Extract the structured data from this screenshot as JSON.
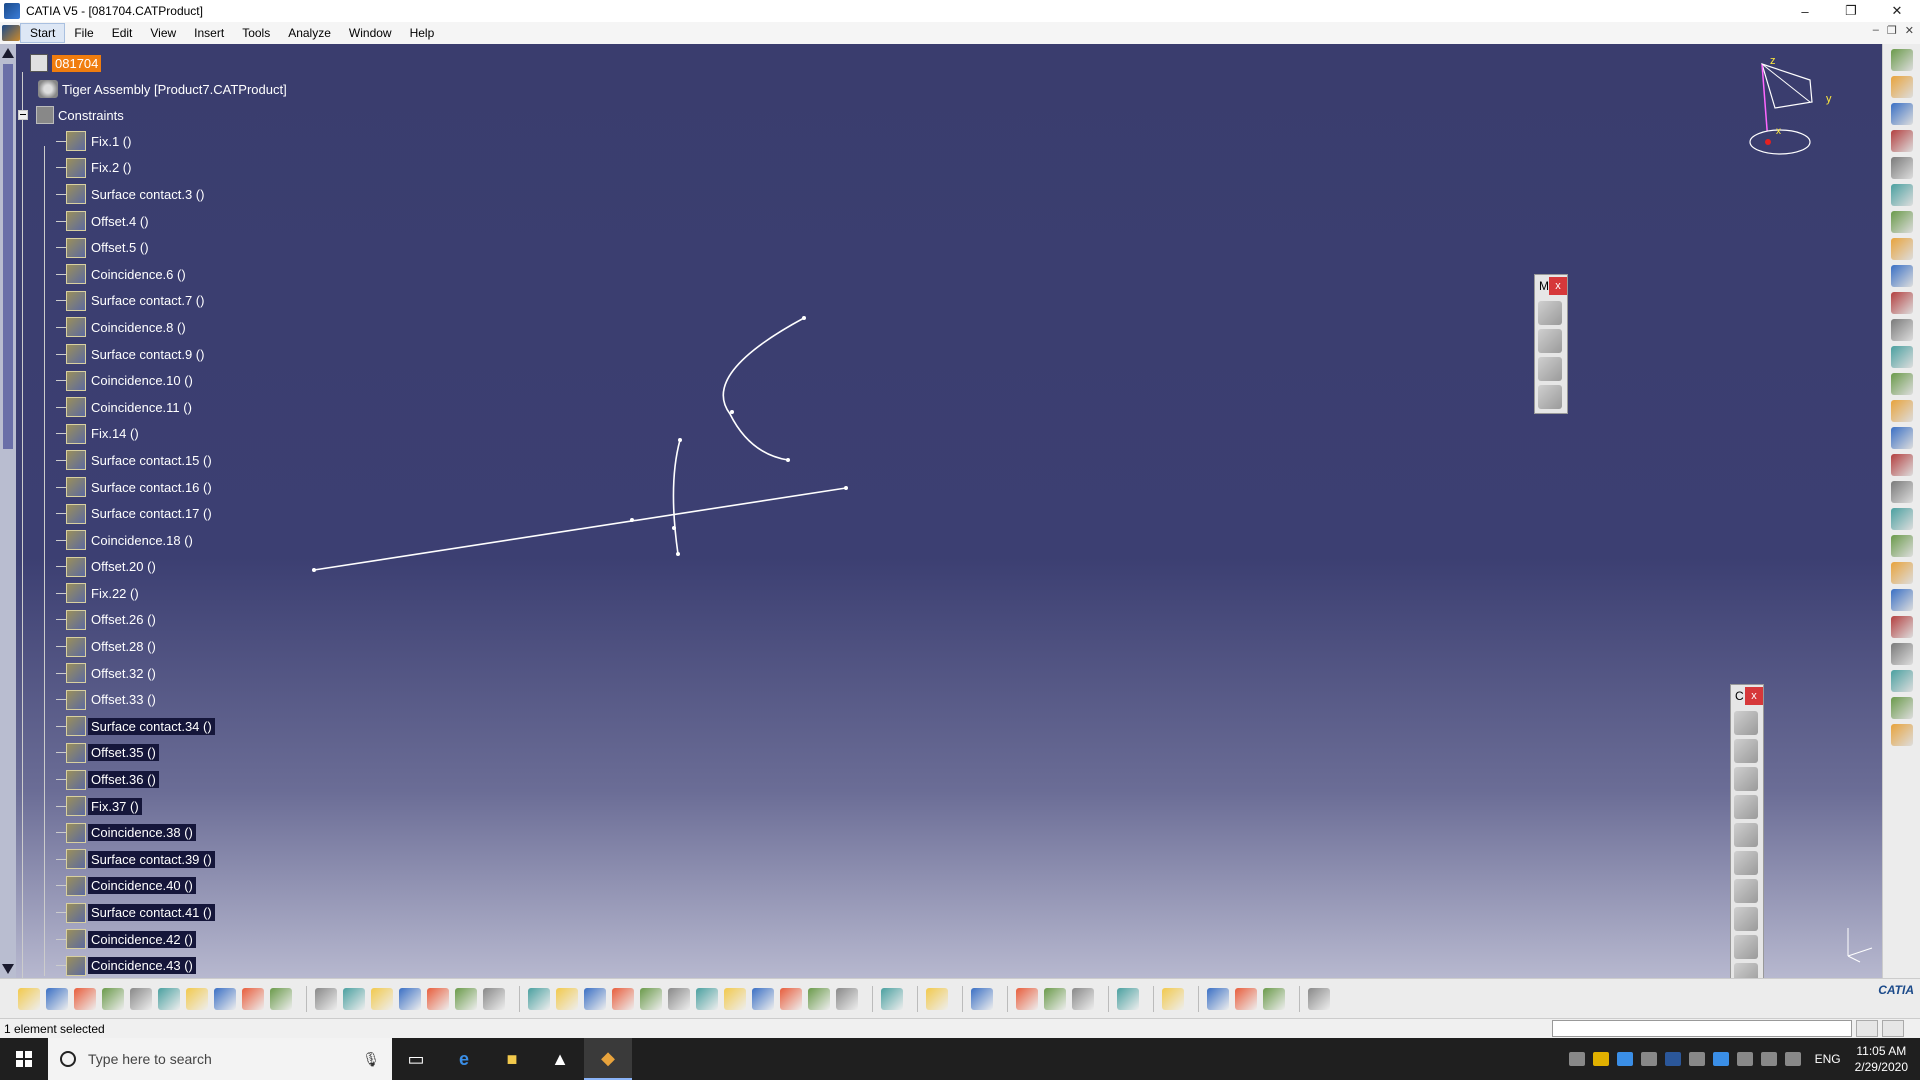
{
  "window": {
    "title": "CATIA V5 - [081704.CATProduct]",
    "minimize": "–",
    "restore": "❐",
    "close": "✕"
  },
  "menu": {
    "items": [
      "Start",
      "File",
      "Edit",
      "View",
      "Insert",
      "Tools",
      "Analyze",
      "Window",
      "Help"
    ]
  },
  "tree": {
    "root_label": "081704",
    "product_label": "Tiger Assembly [Product7.CATProduct]",
    "constraints_label": "Constraints",
    "constraints": [
      {
        "label": "Fix.1 ()",
        "selected": false
      },
      {
        "label": "Fix.2 ()",
        "selected": false
      },
      {
        "label": "Surface contact.3 ()",
        "selected": false
      },
      {
        "label": "Offset.4 ()",
        "selected": false
      },
      {
        "label": "Offset.5 ()",
        "selected": false
      },
      {
        "label": "Coincidence.6 ()",
        "selected": false
      },
      {
        "label": "Surface contact.7 ()",
        "selected": false
      },
      {
        "label": "Coincidence.8 ()",
        "selected": false
      },
      {
        "label": "Surface contact.9 ()",
        "selected": false
      },
      {
        "label": "Coincidence.10 ()",
        "selected": false
      },
      {
        "label": "Coincidence.11 ()",
        "selected": false
      },
      {
        "label": "Fix.14 ()",
        "selected": false
      },
      {
        "label": "Surface contact.15 ()",
        "selected": false
      },
      {
        "label": "Surface contact.16 ()",
        "selected": false
      },
      {
        "label": "Surface contact.17 ()",
        "selected": false
      },
      {
        "label": "Coincidence.18 ()",
        "selected": false
      },
      {
        "label": "Offset.20 ()",
        "selected": false
      },
      {
        "label": "Fix.22 ()",
        "selected": false
      },
      {
        "label": "Offset.26 ()",
        "selected": false
      },
      {
        "label": "Offset.28 ()",
        "selected": false
      },
      {
        "label": "Offset.32 ()",
        "selected": false
      },
      {
        "label": "Offset.33 ()",
        "selected": false
      },
      {
        "label": "Surface contact.34 ()",
        "selected": true
      },
      {
        "label": "Offset.35 ()",
        "selected": true
      },
      {
        "label": "Offset.36 ()",
        "selected": true
      },
      {
        "label": "Fix.37 ()",
        "selected": true
      },
      {
        "label": "Coincidence.38 ()",
        "selected": true
      },
      {
        "label": "Surface contact.39 ()",
        "selected": true
      },
      {
        "label": "Coincidence.40 ()",
        "selected": true
      },
      {
        "label": "Surface contact.41 ()",
        "selected": true
      },
      {
        "label": "Coincidence.42 ()",
        "selected": true
      },
      {
        "label": "Coincidence.43 ()",
        "selected": true
      }
    ]
  },
  "compass": {
    "z_label": "z",
    "y_label": "y",
    "x_label": "x"
  },
  "float_toolbar_1": {
    "title": "M",
    "close": "x",
    "tools": [
      "move-tool",
      "rotate-tool",
      "snap-tool",
      "explode-tool"
    ]
  },
  "float_toolbar_2": {
    "title": "C",
    "close": "x",
    "tools": [
      "coincidence-tool",
      "contact-tool",
      "offset-tool",
      "angle-tool",
      "fix-tool",
      "fix-together-tool",
      "quick-constraint-tool",
      "flexible-tool",
      "change-constraint-tool",
      "reuse-pattern-tool"
    ]
  },
  "right_toolbar_count": 26,
  "bottom_toolbar": {
    "groups": [
      [
        "new",
        "open",
        "save",
        "print",
        "cut",
        "copy",
        "paste",
        "undo",
        "redo",
        "whats-this"
      ],
      [
        "formula",
        "comment",
        "knowledge",
        "table",
        "catalog",
        "measure",
        "analysis"
      ],
      [
        "fly",
        "fit-all",
        "pan",
        "rotate",
        "zoom-in",
        "zoom-out",
        "normal-view",
        "multi-view",
        "iso-view",
        "shading",
        "hide-show",
        "swap"
      ],
      [
        "sketch-grid"
      ],
      [
        "capture"
      ],
      [
        "update"
      ],
      [
        "split",
        "manipulate",
        "snap"
      ],
      [
        "reorder"
      ],
      [
        "section"
      ],
      [
        "render",
        "apply-material",
        "lights"
      ],
      [
        "grid"
      ]
    ],
    "logo": "CATIA"
  },
  "status": {
    "text": "1 element selected",
    "command_placeholder": ""
  },
  "taskbar": {
    "search_placeholder": "Type here to search",
    "mic_icon": "🎙",
    "apps": [
      "task-view",
      "edge",
      "file-explorer",
      "photos",
      "catia"
    ],
    "lang": "ENG",
    "time": "11:05 AM",
    "date": "2/29/2020"
  },
  "colors": {
    "viewport_top": "#3a3d6e",
    "viewport_bottom": "#b7b8cf",
    "root_highlight": "#f07d0e",
    "selected_bg": "#15163a"
  }
}
